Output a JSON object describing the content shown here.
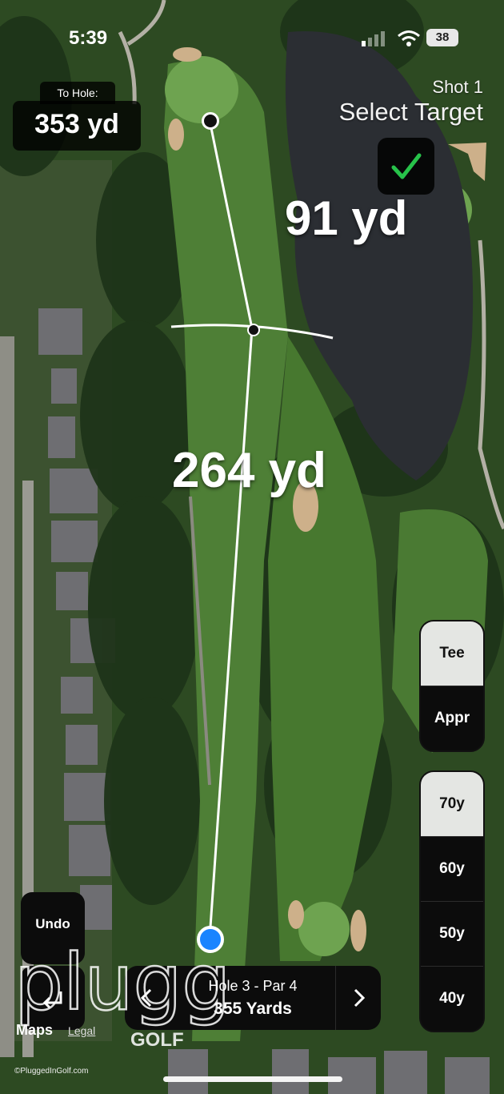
{
  "status_bar": {
    "time": "5:39",
    "battery": "38"
  },
  "to_hole": {
    "label": "To Hole:",
    "value": "353 yd"
  },
  "shot": {
    "label": "Shot 1",
    "instruction": "Select Target"
  },
  "distances": {
    "target_to_hole": "91 yd",
    "tee_to_target": "264 yd"
  },
  "mode_selector": {
    "options": [
      "Tee",
      "Appr"
    ],
    "selected": "Tee"
  },
  "distance_selector": {
    "options": [
      "70y",
      "60y",
      "50y",
      "40y"
    ],
    "selected": "70y"
  },
  "controls": {
    "undo_label": "Undo"
  },
  "hole_nav": {
    "title": "Hole 3 - Par 4",
    "yards": "355 Yards"
  },
  "map_credit": {
    "brand": "Maps",
    "legal": "Legal"
  },
  "watermark": {
    "text": "pluggedin",
    "sub": "GOLF"
  },
  "copyright": "©PluggedInGolf.com",
  "colors": {
    "accent_green": "#27c24a",
    "tee_blue": "#1a84ff",
    "panel_black": "#0c0c0c"
  },
  "icons": {
    "confirm": "checkmark-icon",
    "exit": "exit-icon",
    "prev": "chevron-left-icon",
    "next": "chevron-right-icon"
  }
}
